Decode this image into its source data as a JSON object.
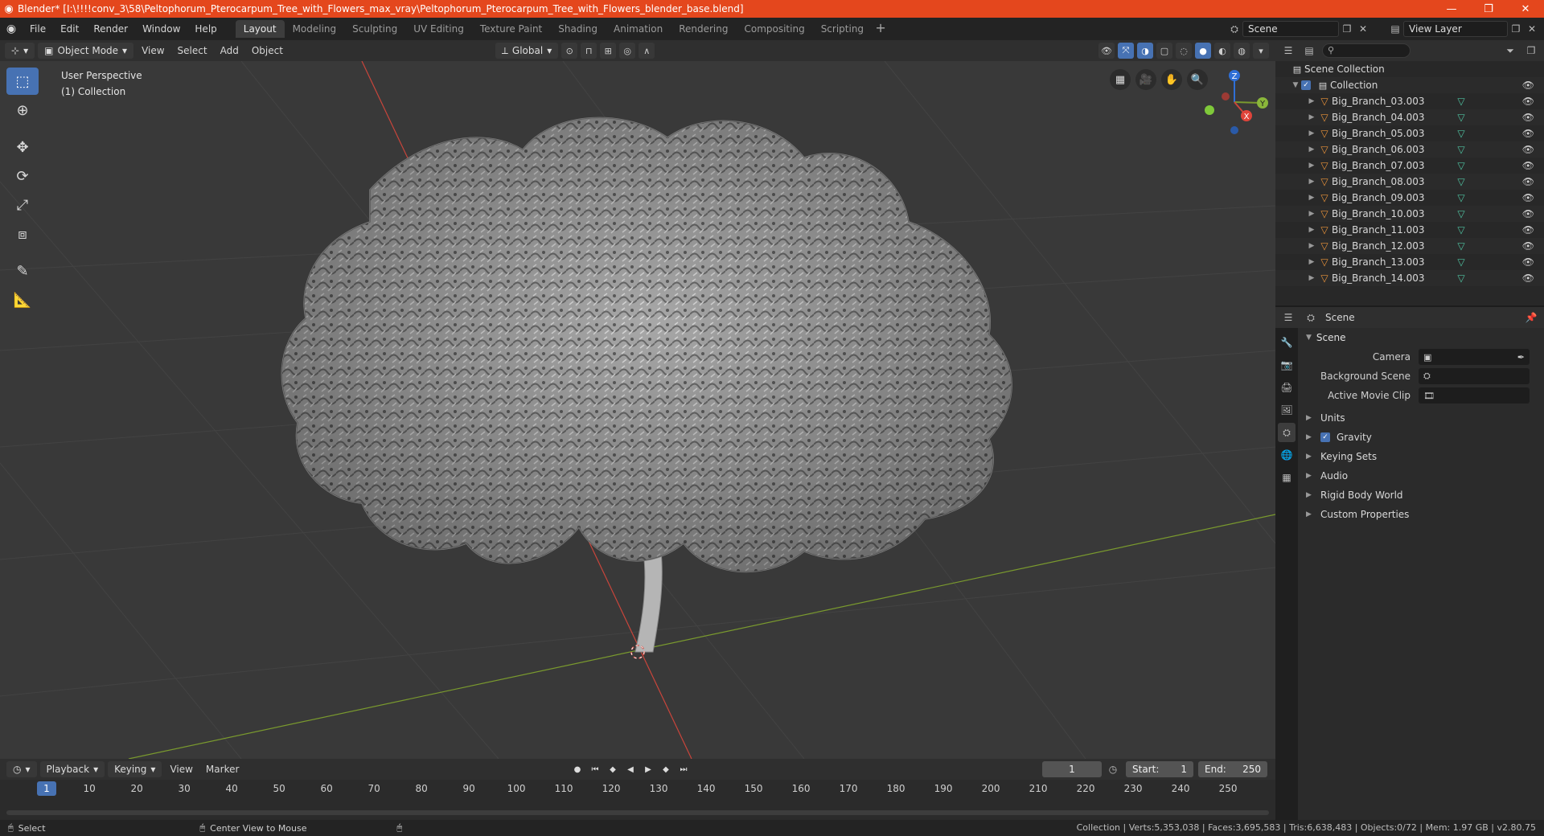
{
  "window": {
    "title": "Blender* [I:\\!!!!conv_3\\58\\Peltophorum_Pterocarpum_Tree_with_Flowers_max_vray\\Peltophorum_Pterocarpum_Tree_with_Flowers_blender_base.blend]",
    "minimize": "—",
    "maximize": "❐",
    "close": "✕"
  },
  "menu": [
    "File",
    "Edit",
    "Render",
    "Window",
    "Help"
  ],
  "workspaces": [
    "Layout",
    "Modeling",
    "Sculpting",
    "UV Editing",
    "Texture Paint",
    "Shading",
    "Animation",
    "Rendering",
    "Compositing",
    "Scripting"
  ],
  "active_workspace": "Layout",
  "scene_name": "Scene",
  "view_layer_name": "View Layer",
  "viewport_header": {
    "mode": "Object Mode",
    "menus": [
      "View",
      "Select",
      "Add",
      "Object"
    ],
    "transform_orientation": "Global"
  },
  "viewport": {
    "perspective_label": "User Perspective",
    "collection_label": "(1) Collection",
    "gizmo_axes": {
      "z": "Z",
      "y": "Y",
      "x": "X"
    }
  },
  "outliner": {
    "search_placeholder": "⚲",
    "scene_collection": "Scene Collection",
    "collection": "Collection",
    "items": [
      "Big_Branch_03.003",
      "Big_Branch_04.003",
      "Big_Branch_05.003",
      "Big_Branch_06.003",
      "Big_Branch_07.003",
      "Big_Branch_08.003",
      "Big_Branch_09.003",
      "Big_Branch_10.003",
      "Big_Branch_11.003",
      "Big_Branch_12.003",
      "Big_Branch_13.003",
      "Big_Branch_14.003"
    ]
  },
  "properties": {
    "context_label": "Scene",
    "panel_title": "Scene",
    "camera_label": "Camera",
    "background_scene_label": "Background Scene",
    "active_clip_label": "Active Movie Clip",
    "subpanels": {
      "units": "Units",
      "gravity": "Gravity",
      "keying_sets": "Keying Sets",
      "audio": "Audio",
      "rigid_body": "Rigid Body World",
      "custom_props": "Custom Properties"
    }
  },
  "timeline": {
    "menus": [
      "Playback",
      "Keying",
      "View",
      "Marker"
    ],
    "current_frame": "1",
    "start_label": "Start:",
    "start_value": "1",
    "end_label": "End:",
    "end_value": "250",
    "ticks": [
      "10",
      "20",
      "30",
      "40",
      "50",
      "60",
      "70",
      "80",
      "90",
      "100",
      "110",
      "120",
      "130",
      "140",
      "150",
      "160",
      "170",
      "180",
      "190",
      "200",
      "210",
      "220",
      "230",
      "240",
      "250"
    ]
  },
  "status": {
    "left_action": "Select",
    "middle_action": "Center View to Mouse",
    "stats": "Collection | Verts:5,353,038 | Faces:3,695,583 | Tris:6,638,483 | Objects:0/72 | Mem: 1.97 GB | v2.80.75"
  },
  "colors": {
    "titlebar": "#e4471d",
    "accent": "#4772b3",
    "x_axis": "#c9453b",
    "y_axis": "#7a9a2e",
    "mesh_icon": "#e8923a",
    "modifier_icon": "#4fc3a1"
  }
}
